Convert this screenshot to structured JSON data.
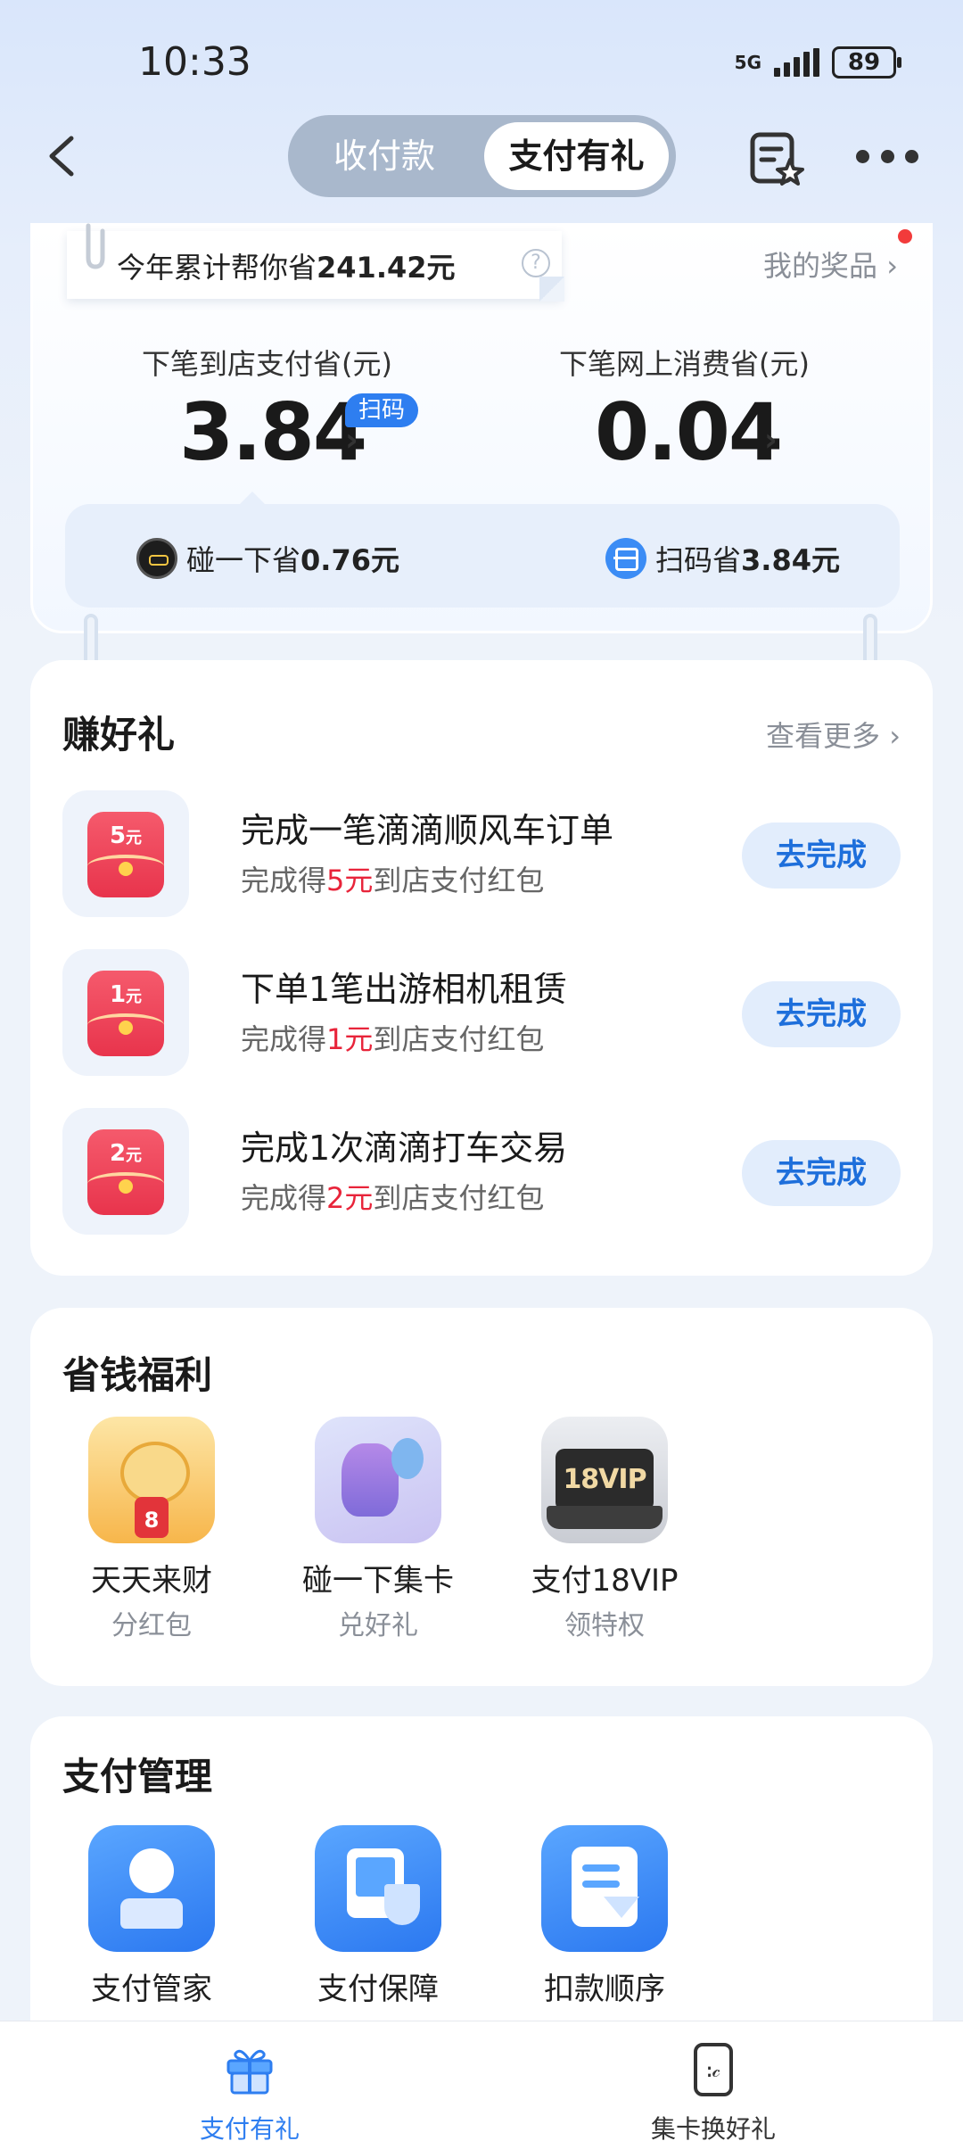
{
  "status_bar": {
    "time": "10:33",
    "network": "5G",
    "battery": "89"
  },
  "nav": {
    "tabs": [
      {
        "label": "收付款",
        "active": false
      },
      {
        "label": "支付有礼",
        "active": true
      }
    ]
  },
  "savings": {
    "note_prefix": "今年累计帮你省",
    "note_amount": "241.42元",
    "help": "?",
    "prizes_link": "我的奖品",
    "store_label": "下笔到店支付省(元)",
    "store_value": "3.84",
    "store_badge": "扫码",
    "online_label": "下笔网上消费省(元)",
    "online_value": "0.04",
    "tap_prefix": "碰一下省",
    "tap_amount": "0.76元",
    "scan_prefix": "扫码省",
    "scan_amount": "3.84元"
  },
  "earn": {
    "title": "赚好礼",
    "more": "查看更多",
    "tasks": [
      {
        "amount": "5",
        "unit": "元",
        "title": "完成一笔滴滴顺风车订单",
        "sub_prefix": "完成得",
        "sub_amount": "5元",
        "sub_suffix": "到店支付红包",
        "button": "去完成"
      },
      {
        "amount": "1",
        "unit": "元",
        "title": "下单1笔出游相机租赁",
        "sub_prefix": "完成得",
        "sub_amount": "1元",
        "sub_suffix": "到店支付红包",
        "button": "去完成"
      },
      {
        "amount": "2",
        "unit": "元",
        "title": "完成1次滴滴打车交易",
        "sub_prefix": "完成得",
        "sub_amount": "2元",
        "sub_suffix": "到店支付红包",
        "button": "去完成"
      }
    ]
  },
  "welfare": {
    "title": "省钱福利",
    "items": [
      {
        "icon": "dragon-mascot-icon",
        "label": "天天来财",
        "sub": "分红包"
      },
      {
        "icon": "card-collect-icon",
        "label": "碰一下集卡",
        "sub": "兑好礼"
      },
      {
        "icon": "vip-icon",
        "label": "支付18VIP",
        "sub": "领特权",
        "icon_text": "18VIP"
      }
    ]
  },
  "manage": {
    "title": "支付管理",
    "items": [
      {
        "icon": "steward-icon",
        "label": "支付管家"
      },
      {
        "icon": "security-icon",
        "label": "支付保障"
      },
      {
        "icon": "order-icon",
        "label": "扣款顺序"
      }
    ]
  },
  "tab_bar": {
    "items": [
      {
        "icon": "gift-icon",
        "label": "支付有礼",
        "active": true
      },
      {
        "icon": "card-exchange-icon",
        "label": "集卡换好礼",
        "active": false
      }
    ]
  },
  "colors": {
    "accent": "#2e7ef0",
    "red": "#e8243a",
    "button_bg": "#e2edfc"
  }
}
